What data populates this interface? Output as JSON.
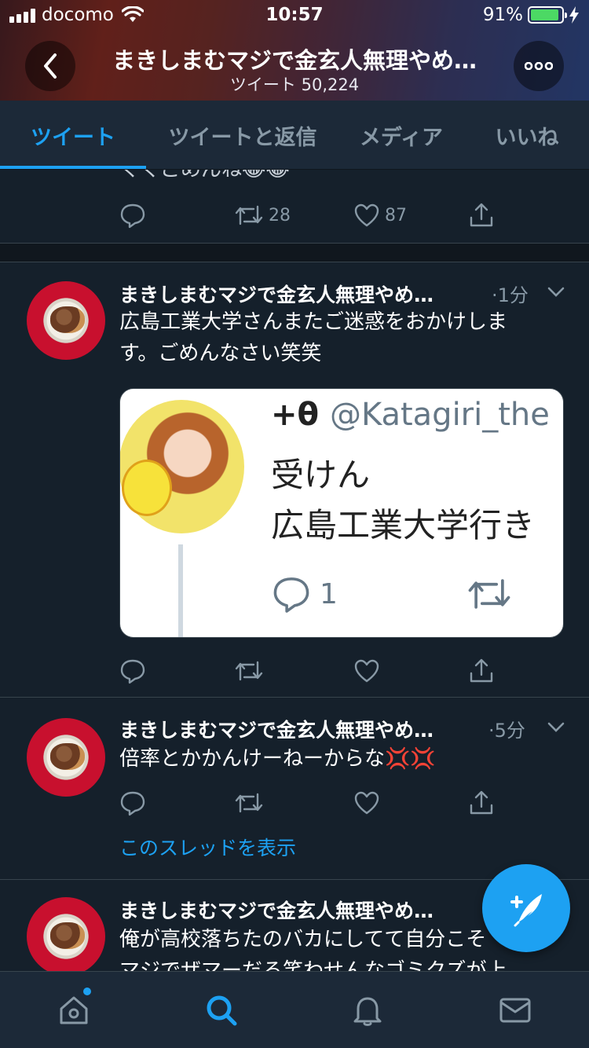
{
  "status_bar": {
    "carrier": "docomo",
    "time": "10:57",
    "battery_percent": "91%",
    "battery_level": 0.91
  },
  "header": {
    "title": "まきしまむマジで金玄人無理やめ…",
    "subtitle": "ツイート 50,224"
  },
  "tabs": [
    {
      "label": "ツイート",
      "active": true
    },
    {
      "label": "ツイートと返信",
      "active": false
    },
    {
      "label": "メディア",
      "active": false
    },
    {
      "label": "いいね",
      "active": false
    }
  ],
  "partial_tweet": {
    "text_fragment": "くくごめんね😂😂",
    "retweets": "28",
    "likes": "87"
  },
  "tweets": [
    {
      "name": "まきしまむマジで金玄人無理やめ…",
      "time": "·1分",
      "text_line1": "広島工業大学さんまたご迷惑をおかけしま",
      "text_line2": "す。ごめんなさい笑笑",
      "card": {
        "name": "+θ",
        "handle": "@Katagiri_the",
        "line1": "受けん",
        "line2": "広島工業大学行き",
        "reply_count": "1"
      }
    },
    {
      "name": "まきしまむマジで金玄人無理やめ…",
      "time": "·5分",
      "text_line1": "倍率とかかんけーねーからな💢💢",
      "thread_link": "このスレッドを表示"
    },
    {
      "name": "まきしまむマジで金玄人無理やめ…",
      "text_line1": "俺が高校落ちたのバカにしてて自分こそ",
      "text_line2": "マジでザマーだる笑わせんなゴミクズが上"
    }
  ],
  "bottom_nav": [
    "home",
    "search",
    "notifications",
    "messages"
  ],
  "colors": {
    "background": "#15202b",
    "accent": "#1da1f2",
    "muted": "#8899a6",
    "divider": "#38444d"
  }
}
